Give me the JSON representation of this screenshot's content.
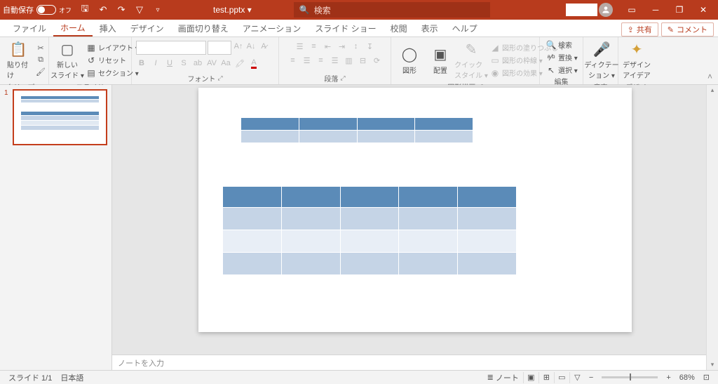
{
  "titlebar": {
    "autosave_label": "自動保存",
    "autosave_state": "オフ",
    "filename": "test.pptx  ▾",
    "search_placeholder": "検索"
  },
  "tabs": {
    "file": "ファイル",
    "home": "ホーム",
    "insert": "挿入",
    "design": "デザイン",
    "transitions": "画面切り替え",
    "animations": "アニメーション",
    "slideshow": "スライド ショー",
    "review": "校閲",
    "view": "表示",
    "help": "ヘルプ",
    "share": "共有",
    "comments": "コメント"
  },
  "ribbon": {
    "clipboard": {
      "label": "クリップボード",
      "paste": "貼り付け"
    },
    "slides": {
      "label": "スライド",
      "new": "新しい\nスライド ▾",
      "layout": "レイアウト ▾",
      "reset": "リセット",
      "section": "セクション ▾"
    },
    "font": {
      "label": "フォント"
    },
    "paragraph": {
      "label": "段落"
    },
    "drawing": {
      "label": "図形描画",
      "shapes": "図形",
      "arrange": "配置",
      "quick": "クイック\nスタイル ▾",
      "fill": "図形の塗りつぶし ▾",
      "outline": "図形の枠線 ▾",
      "effects": "図形の効果 ▾"
    },
    "editing": {
      "label": "編集",
      "find": "検索",
      "replace": "置換 ▾",
      "select": "選択 ▾"
    },
    "voice": {
      "label": "音声",
      "dictate": "ディクテー\nション ▾"
    },
    "designer": {
      "label": "デザイナー",
      "ideas": "デザイン\nアイデア"
    }
  },
  "notes_placeholder": "ノートを入力",
  "status": {
    "slide": "スライド 1/1",
    "lang": "日本語",
    "notes": "ノート",
    "zoom": "68%"
  },
  "chart_data": [
    {
      "type": "table",
      "rows": 2,
      "cols": 4,
      "header_rows": 1,
      "position": "top",
      "theme": "medium-accent1"
    },
    {
      "type": "table",
      "rows": 4,
      "cols": 5,
      "header_rows": 1,
      "position": "center",
      "theme": "medium-accent1-banded"
    }
  ]
}
